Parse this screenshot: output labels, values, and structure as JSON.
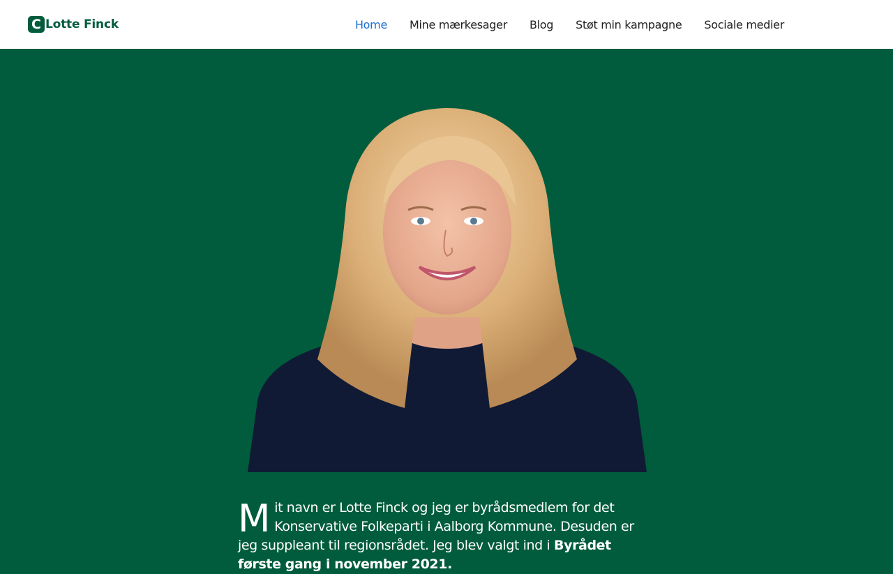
{
  "brand": {
    "logo_letter": "C",
    "name": "Lotte Finck"
  },
  "nav": {
    "items": [
      {
        "label": "Home",
        "active": true
      },
      {
        "label": "Mine mærkesager",
        "active": false
      },
      {
        "label": "Blog",
        "active": false
      },
      {
        "label": "Støt min kampagne",
        "active": false
      },
      {
        "label": "Sociale medier",
        "active": false
      }
    ]
  },
  "hero": {
    "intro_dropcap": "M",
    "intro_text": "it navn er Lotte Finck og jeg er byrådsmedlem for det Konservative Folkeparti i Aalborg Kommune. Desuden er jeg suppleant til regionsrådet. Jeg blev valgt ind i ",
    "intro_bold": "Byrådet første gang i november 2021."
  },
  "colors": {
    "brand_green": "#005c3c",
    "nav_active": "#1b6fd6",
    "nav_text": "#1f1f1f"
  }
}
